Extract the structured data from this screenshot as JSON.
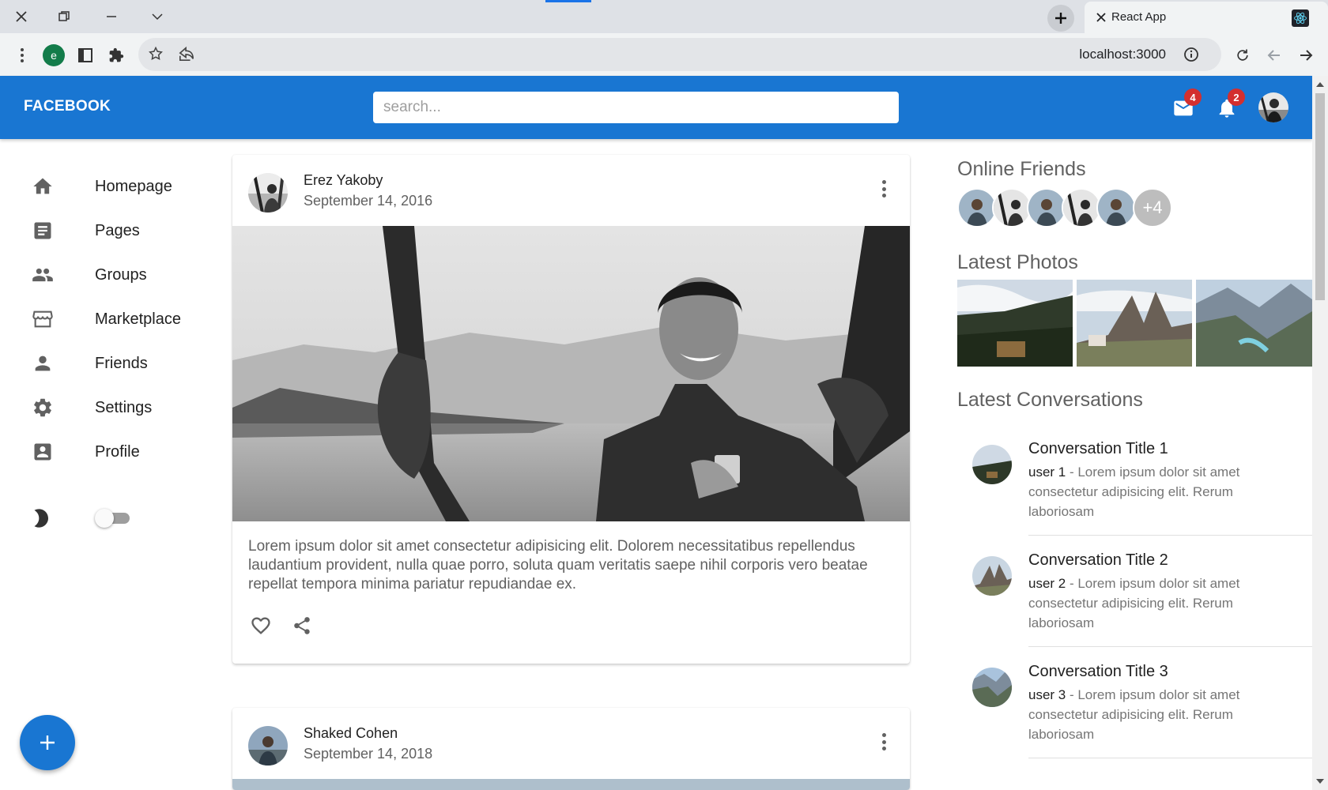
{
  "browser": {
    "tab_title": "React App",
    "url": "localhost:3000",
    "profile_initial": "e"
  },
  "appbar": {
    "logo": "FACEBOOK",
    "search_placeholder": "search...",
    "mail_badge": "4",
    "notification_badge": "2",
    "brand_color": "#1976d2"
  },
  "sidebar": {
    "items": [
      {
        "label": "Homepage",
        "icon": "home-icon"
      },
      {
        "label": "Pages",
        "icon": "article-icon"
      },
      {
        "label": "Groups",
        "icon": "people-icon"
      },
      {
        "label": "Marketplace",
        "icon": "storefront-icon"
      },
      {
        "label": "Friends",
        "icon": "person-icon"
      },
      {
        "label": "Settings",
        "icon": "settings-icon"
      },
      {
        "label": "Profile",
        "icon": "account-box-icon"
      }
    ],
    "theme_toggle_on": false
  },
  "feed": {
    "posts": [
      {
        "author": "Erez Yakoby",
        "date": "September 14, 2016",
        "text": "Lorem ipsum dolor sit amet consectetur adipisicing elit. Dolorem necessitatibus repellendus laudantium provident, nulla quae porro, soluta quam veritatis saepe nihil corporis vero beatae repellat tempora minima pariatur repudiandae ex."
      },
      {
        "author": "Shaked Cohen",
        "date": "September 14, 2018"
      }
    ]
  },
  "rightbar": {
    "online_friends_title": "Online Friends",
    "online_friends_more": "+4",
    "latest_photos_title": "Latest Photos",
    "latest_conversations_title": "Latest Conversations",
    "conversations": [
      {
        "title": "Conversation Title 1",
        "user": "user 1",
        "preview": " - Lorem ipsum dolor sit amet consectetur adipisicing elit. Rerum laboriosam"
      },
      {
        "title": "Conversation Title 2",
        "user": "user 2",
        "preview": " - Lorem ipsum dolor sit amet consectetur adipisicing elit. Rerum laboriosam"
      },
      {
        "title": "Conversation Title 3",
        "user": "user 3",
        "preview": " - Lorem ipsum dolor sit amet consectetur adipisicing elit. Rerum laboriosam"
      }
    ]
  }
}
